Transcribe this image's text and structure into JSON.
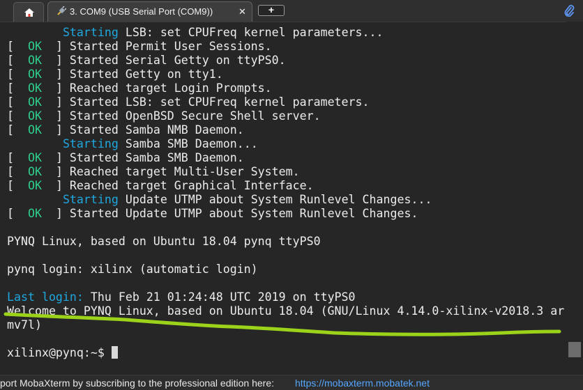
{
  "tabs": {
    "home_icon": "home-icon",
    "active_label": "3. COM9  (USB Serial Port (COM9))",
    "active_close": "✕",
    "new_tab_label": "+",
    "attach_icon": "paperclip-icon"
  },
  "terminal": {
    "lines": [
      [
        {
          "t": "        "
        },
        {
          "t": "Starting",
          "c": "cyan"
        },
        {
          "t": " LSB: set CPUFreq kernel parameters..."
        }
      ],
      [
        {
          "t": "[  "
        },
        {
          "t": "OK",
          "c": "ok"
        },
        {
          "t": "  ] Started Permit User Sessions."
        }
      ],
      [
        {
          "t": "[  "
        },
        {
          "t": "OK",
          "c": "ok"
        },
        {
          "t": "  ] Started Serial Getty on ttyPS0."
        }
      ],
      [
        {
          "t": "[  "
        },
        {
          "t": "OK",
          "c": "ok"
        },
        {
          "t": "  ] Started Getty on tty1."
        }
      ],
      [
        {
          "t": "[  "
        },
        {
          "t": "OK",
          "c": "ok"
        },
        {
          "t": "  ] Reached target Login Prompts."
        }
      ],
      [
        {
          "t": "[  "
        },
        {
          "t": "OK",
          "c": "ok"
        },
        {
          "t": "  ] Started LSB: set CPUFreq kernel parameters."
        }
      ],
      [
        {
          "t": "[  "
        },
        {
          "t": "OK",
          "c": "ok"
        },
        {
          "t": "  ] Started OpenBSD Secure Shell server."
        }
      ],
      [
        {
          "t": "[  "
        },
        {
          "t": "OK",
          "c": "ok"
        },
        {
          "t": "  ] Started Samba NMB Daemon."
        }
      ],
      [
        {
          "t": "        "
        },
        {
          "t": "Starting",
          "c": "cyan"
        },
        {
          "t": " Samba SMB Daemon..."
        }
      ],
      [
        {
          "t": "[  "
        },
        {
          "t": "OK",
          "c": "ok"
        },
        {
          "t": "  ] Started Samba SMB Daemon."
        }
      ],
      [
        {
          "t": "[  "
        },
        {
          "t": "OK",
          "c": "ok"
        },
        {
          "t": "  ] Reached target Multi-User System."
        }
      ],
      [
        {
          "t": "[  "
        },
        {
          "t": "OK",
          "c": "ok"
        },
        {
          "t": "  ] Reached target Graphical Interface."
        }
      ],
      [
        {
          "t": "        "
        },
        {
          "t": "Starting",
          "c": "cyan"
        },
        {
          "t": " Update UTMP about System Runlevel Changes..."
        }
      ],
      [
        {
          "t": "[  "
        },
        {
          "t": "OK",
          "c": "ok"
        },
        {
          "t": "  ] Started Update UTMP about System Runlevel Changes."
        }
      ],
      [],
      [
        {
          "t": "PYNQ Linux, based on Ubuntu 18.04 pynq ttyPS0"
        }
      ],
      [],
      [
        {
          "t": "pynq login: xilinx (automatic login)"
        }
      ],
      [],
      [
        {
          "t": "Last login:",
          "c": "cyan"
        },
        {
          "t": " Thu Feb 21 01:24:48 UTC 2019 on ttyPS0"
        }
      ],
      [
        {
          "t": "Welcome to PYNQ Linux, based on Ubuntu 18.04 (GNU/Linux 4.14.0-xilinx-v2018.3 ar"
        }
      ],
      [
        {
          "t": "mv7l)"
        }
      ],
      [],
      [
        {
          "t": "xilinx@pynq:~$ "
        }
      ]
    ]
  },
  "colors": {
    "ok": "#2fcf8e",
    "starting": "#1fa7df",
    "highlight_stroke": "#9bd21a"
  },
  "status": {
    "text": "port MobaXterm by subscribing to the professional edition here:",
    "link": "https://mobaxterm.mobatek.net"
  }
}
